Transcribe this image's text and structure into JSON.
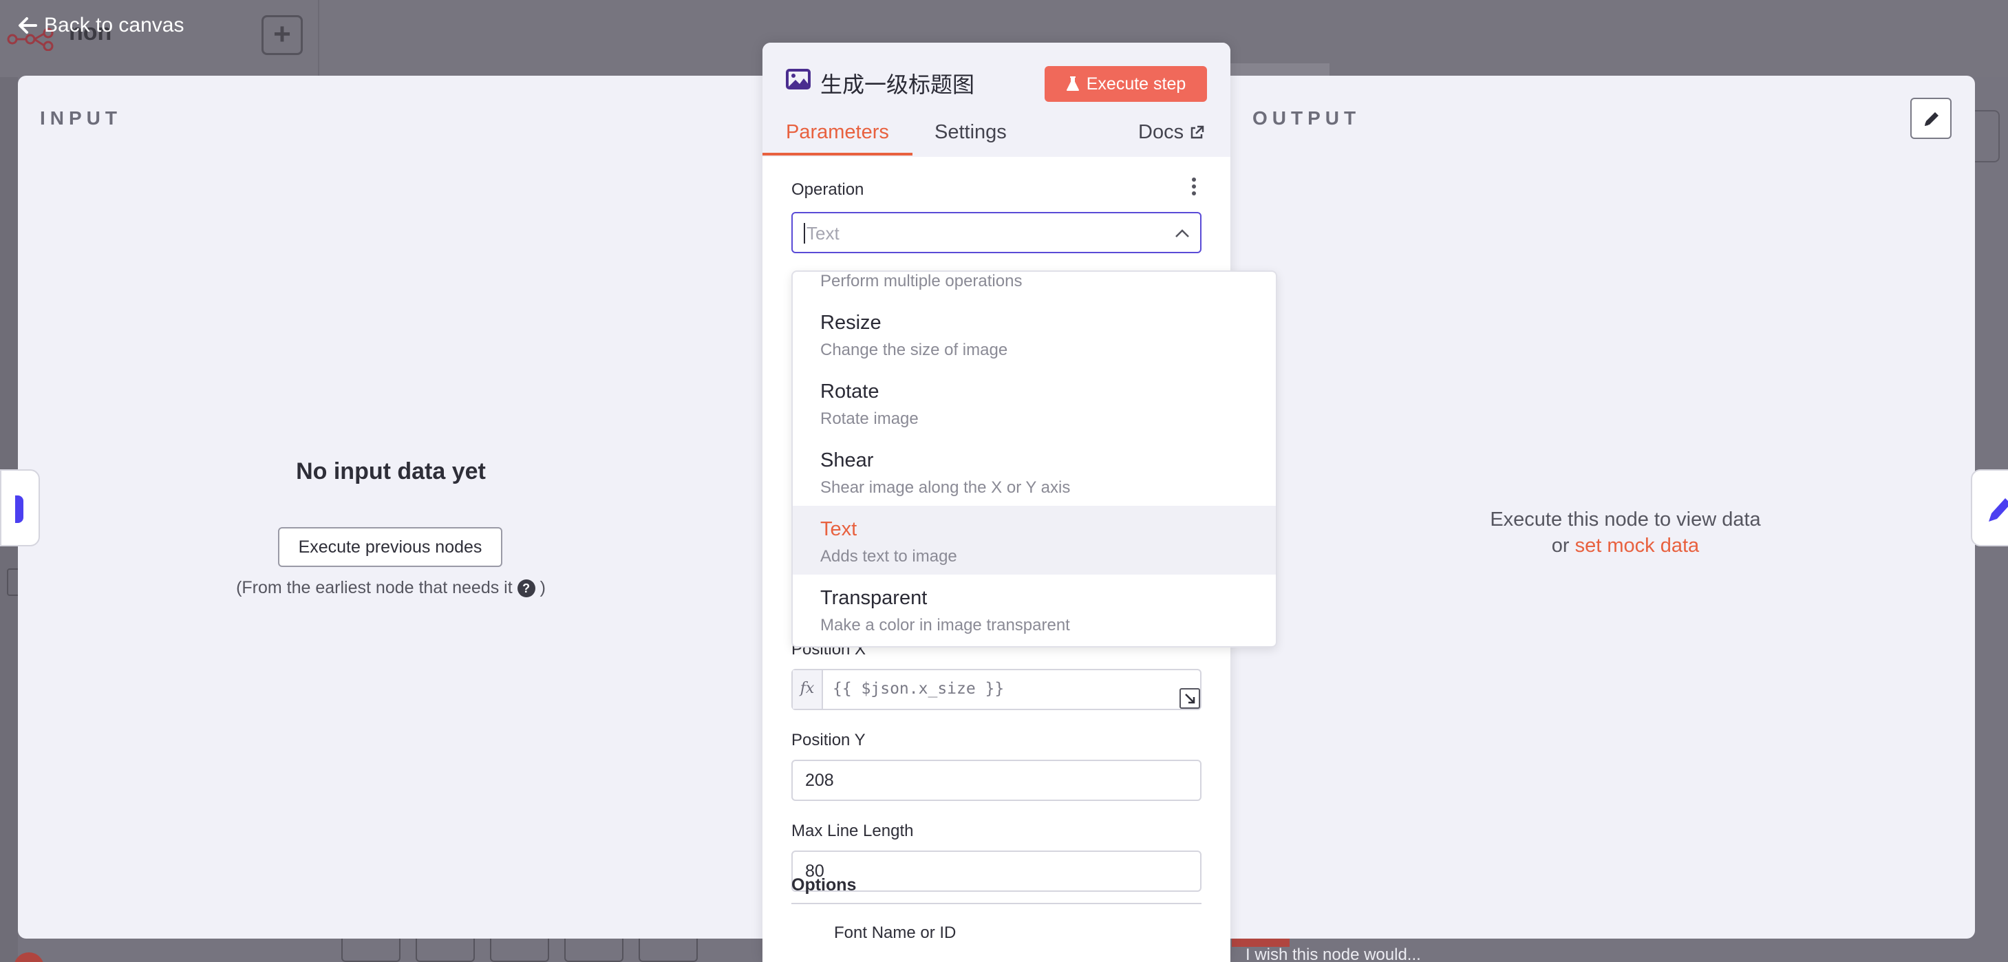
{
  "background": {
    "back_link": "Back to canvas",
    "workflow_name": "non",
    "wish_text": "I wish this node would..."
  },
  "input_panel": {
    "title": "INPUT",
    "empty_title": "No input data yet",
    "execute_previous_label": "Execute previous nodes",
    "note_before": "(From the earliest node that needs it",
    "note_after": ")"
  },
  "output_panel": {
    "title": "OUTPUT",
    "message_line1": "Execute this node to view data",
    "message_or": "or",
    "mock_link": "set mock data"
  },
  "node": {
    "title": "生成一级标题图",
    "execute_label": "Execute step",
    "tabs": [
      {
        "label": "Parameters",
        "active": true
      },
      {
        "label": "Settings",
        "active": false
      },
      {
        "label": "Docs",
        "active": false
      }
    ],
    "operation": {
      "label": "Operation",
      "placeholder": "Text"
    },
    "position_x": {
      "label": "Position X",
      "value": "{{ $json.x_size }}"
    },
    "position_y": {
      "label": "Position Y",
      "value": "208"
    },
    "max_line_length": {
      "label": "Max Line Length",
      "value": "80"
    },
    "options_label": "Options",
    "options_item": "Font Name or ID"
  },
  "dropdown": {
    "partial_desc": "Perform multiple operations",
    "items": [
      {
        "label": "Resize",
        "description": "Change the size of image"
      },
      {
        "label": "Rotate",
        "description": "Rotate image"
      },
      {
        "label": "Shear",
        "description": "Shear image along the X or Y axis"
      },
      {
        "label": "Text",
        "description": "Adds text to image",
        "selected": true
      },
      {
        "label": "Transparent",
        "description": "Make a color in image transparent"
      }
    ]
  },
  "colors": {
    "accent": "#e8613f",
    "execute": "#f0695a",
    "focus": "#5a4bd6",
    "overlay": "#76747f",
    "panel_bg": "#f1f1f8"
  },
  "icons": [
    "arrow-left-icon",
    "plus-icon",
    "image-icon",
    "flask-icon",
    "external-link-icon",
    "kebab-icon",
    "chevron-up-icon",
    "help-icon",
    "pencil-icon",
    "expand-icon"
  ]
}
